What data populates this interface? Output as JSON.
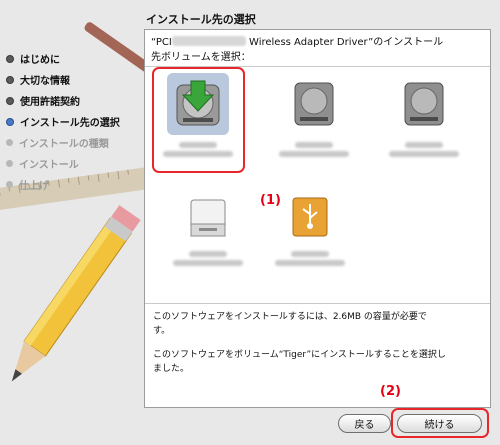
{
  "title": "インストール先の選択",
  "steps": [
    {
      "label": "はじめに",
      "state": "done"
    },
    {
      "label": "大切な情報",
      "state": "done"
    },
    {
      "label": "使用許諾契約",
      "state": "done"
    },
    {
      "label": "インストール先の選択",
      "state": "current"
    },
    {
      "label": "インストールの種類",
      "state": "future"
    },
    {
      "label": "インストール",
      "state": "future"
    },
    {
      "label": "仕上げ",
      "state": "future"
    }
  ],
  "prompt": {
    "prefix": "“PCI",
    "suffix": " Wireless Adapter Driver”のインストール",
    "line2": "先ボリュームを選択："
  },
  "volumes": [
    {
      "icon": "hard-disk-install-icon",
      "selected": true
    },
    {
      "icon": "hard-disk-icon",
      "selected": false
    },
    {
      "icon": "hard-disk-icon",
      "selected": false
    },
    {
      "icon": "external-drive-icon",
      "selected": false
    },
    {
      "icon": "usb-drive-icon",
      "selected": false
    }
  ],
  "callouts": {
    "one": "(1)",
    "two": "(2)"
  },
  "message": {
    "line1": "このソフトウェアをインストールするには、2.6MB の容量が必要で",
    "line1b": "す。",
    "line2": "このソフトウェアをボリューム“Tiger”にインストールすることを選択し",
    "line2b": "ました。"
  },
  "buttons": {
    "back": "戻る",
    "continue": "続ける"
  },
  "colors": {
    "accent_red": "#e60012",
    "selection": "#b9c8dc",
    "usb_orange": "#e8a334"
  }
}
